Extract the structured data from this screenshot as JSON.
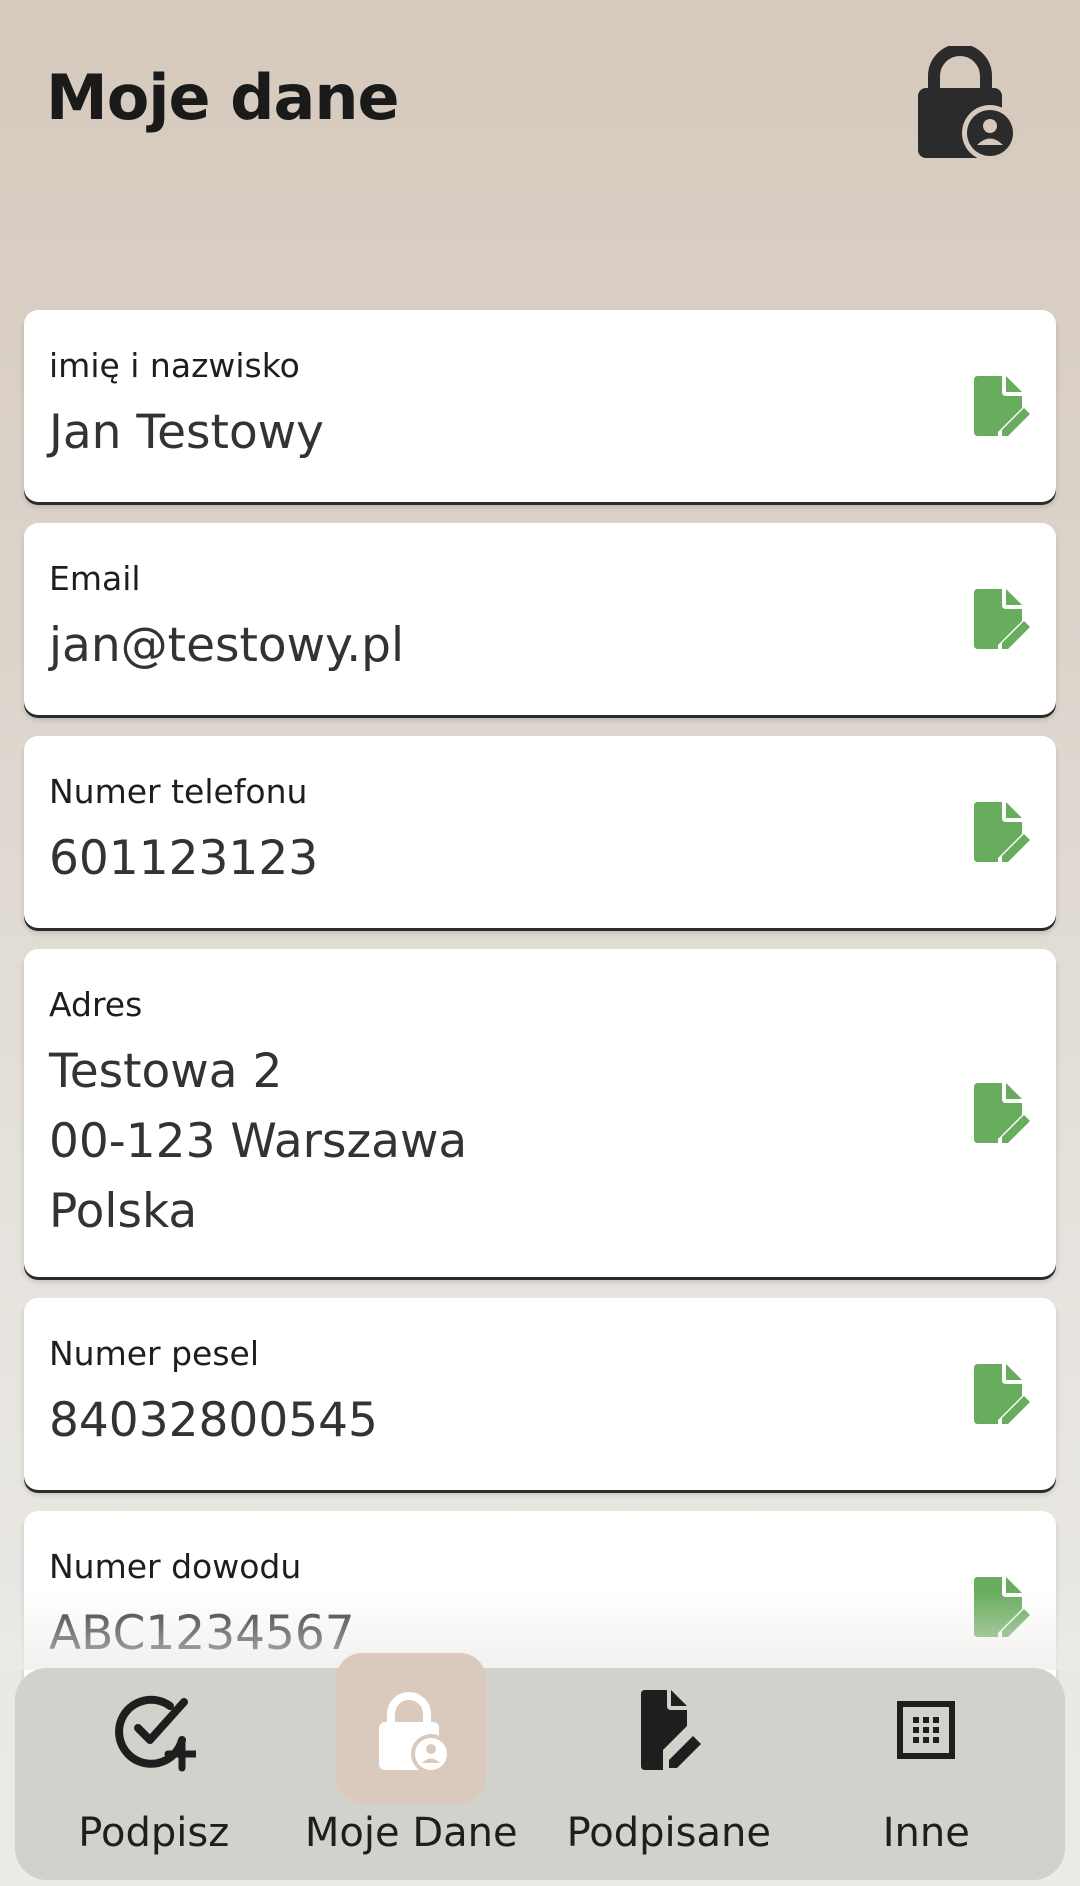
{
  "header": {
    "title": "Moje dane",
    "icon": "lock-user-icon"
  },
  "fields": [
    {
      "label": "imię i nazwisko",
      "value": "Jan Testowy",
      "icon": "edit-document-icon"
    },
    {
      "label": "Email",
      "value": "jan@testowy.pl",
      "icon": "edit-document-icon"
    },
    {
      "label": "Numer telefonu",
      "value": "601123123",
      "icon": "edit-document-icon"
    },
    {
      "label": "Adres",
      "value": "Testowa 2\n00-123 Warszawa\nPolska",
      "icon": "edit-document-icon"
    },
    {
      "label": "Numer pesel",
      "value": "84032800545",
      "icon": "edit-document-icon"
    },
    {
      "label": "Numer dowodu",
      "value": "ABC1234567",
      "icon": "edit-document-icon"
    }
  ],
  "bottom_nav": {
    "items": [
      {
        "label": "Podpisz",
        "icon": "check-circle-plus-icon",
        "active": false
      },
      {
        "label": "Moje Dane",
        "icon": "lock-user-icon",
        "active": true
      },
      {
        "label": "Podpisane",
        "icon": "document-edit-icon",
        "active": false
      },
      {
        "label": "Inne",
        "icon": "grid-dots-icon",
        "active": false
      }
    ]
  },
  "colors": {
    "accent_green": "#68ac5d",
    "header_bg": "#d6c9bd",
    "nav_bg": "#d2d2cd",
    "nav_active_bg": "#dacabd",
    "icon_dark": "#2b2b2b"
  }
}
